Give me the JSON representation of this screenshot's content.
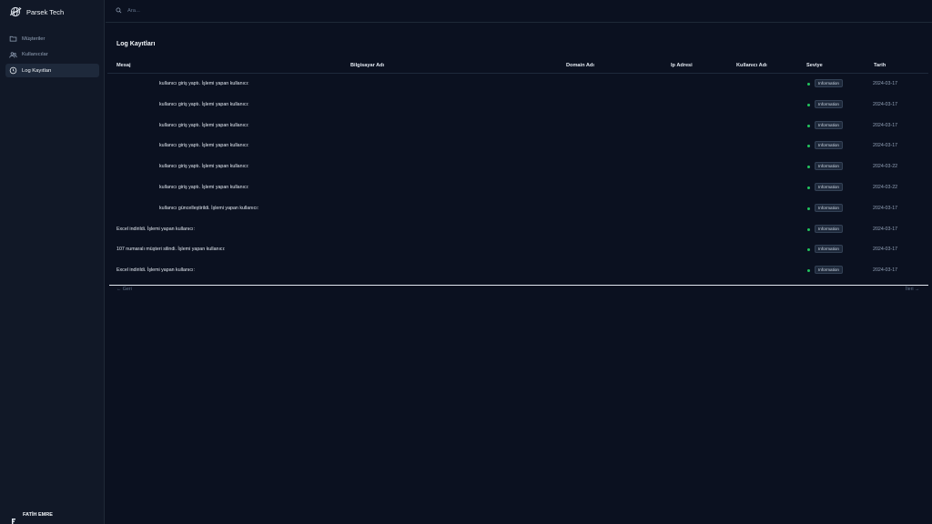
{
  "brand": {
    "name": "Parsek Tech",
    "logo_icon": "globe-plane-icon"
  },
  "sidebar": {
    "items": [
      {
        "label": "Müşteriler",
        "icon": "folder-icon",
        "active": false
      },
      {
        "label": "Kullanıcılar",
        "icon": "users-icon",
        "active": false
      },
      {
        "label": "Log Kayıtları",
        "icon": "clock-icon",
        "active": true
      }
    ],
    "user": {
      "name": "FATİH EMRE"
    }
  },
  "search": {
    "placeholder": "Ara..."
  },
  "page": {
    "title": "Log Kayıtları"
  },
  "table": {
    "columns": [
      "Mesaj",
      "Bilgisayar Adı",
      "Domain Adı",
      "Ip Adresi",
      "Kullanıcı Adı",
      "Seviye",
      "Tarih"
    ],
    "rows": [
      {
        "message": "kullanıcı giriş yaptı. İşlemi yapan kullanıcı:",
        "indented": true,
        "computer": "",
        "domain": "",
        "ip": "",
        "username": "",
        "level": "Information",
        "date": "2024-03-17"
      },
      {
        "message": "kullanıcı giriş yaptı. İşlemi yapan kullanıcı:",
        "indented": true,
        "computer": "",
        "domain": "",
        "ip": "",
        "username": "",
        "level": "Information",
        "date": "2024-03-17"
      },
      {
        "message": "kullanıcı giriş yaptı. İşlemi yapan kullanıcı:",
        "indented": true,
        "computer": "",
        "domain": "",
        "ip": "",
        "username": "",
        "level": "Information",
        "date": "2024-03-17"
      },
      {
        "message": "kullanıcı giriş yaptı. İşlemi yapan kullanıcı:",
        "indented": true,
        "computer": "",
        "domain": "",
        "ip": "",
        "username": "",
        "level": "Information",
        "date": "2024-03-17"
      },
      {
        "message": "kullanıcı giriş yaptı. İşlemi yapan kullanıcı:",
        "indented": true,
        "computer": "",
        "domain": "",
        "ip": "",
        "username": "",
        "level": "Information",
        "date": "2024-03-22"
      },
      {
        "message": "kullanıcı giriş yaptı. İşlemi yapan kullanıcı:",
        "indented": true,
        "computer": "",
        "domain": "",
        "ip": "",
        "username": "",
        "level": "Information",
        "date": "2024-03-22"
      },
      {
        "message": "kullanıcı güncelleştirildi. İşlemi yapan kullanıcı:",
        "indented": true,
        "computer": "",
        "domain": "",
        "ip": "",
        "username": "",
        "level": "Information",
        "date": "2024-03-17"
      },
      {
        "message": "Excel indirildi. İşlemi yapan kullanıcı:",
        "indented": false,
        "computer": "",
        "domain": "",
        "ip": "",
        "username": "",
        "level": "Information",
        "date": "2024-03-17"
      },
      {
        "message": "107 numaralı müşteri silindi. İşlemi yapan kullanıcı:",
        "indented": false,
        "computer": "",
        "domain": "",
        "ip": "",
        "username": "",
        "level": "Information",
        "date": "2024-03-17"
      },
      {
        "message": "Excel indirildi. İşlemi yapan kullanıcı:",
        "indented": false,
        "computer": "",
        "domain": "",
        "ip": "",
        "username": "",
        "level": "Information",
        "date": "2024-03-17"
      }
    ]
  },
  "pagination": {
    "prev_label": "← Geri",
    "next_label": "İleri →"
  },
  "colors": {
    "background": "#0b1120",
    "sidebar": "#111827",
    "level_dot": "#22c55e"
  }
}
